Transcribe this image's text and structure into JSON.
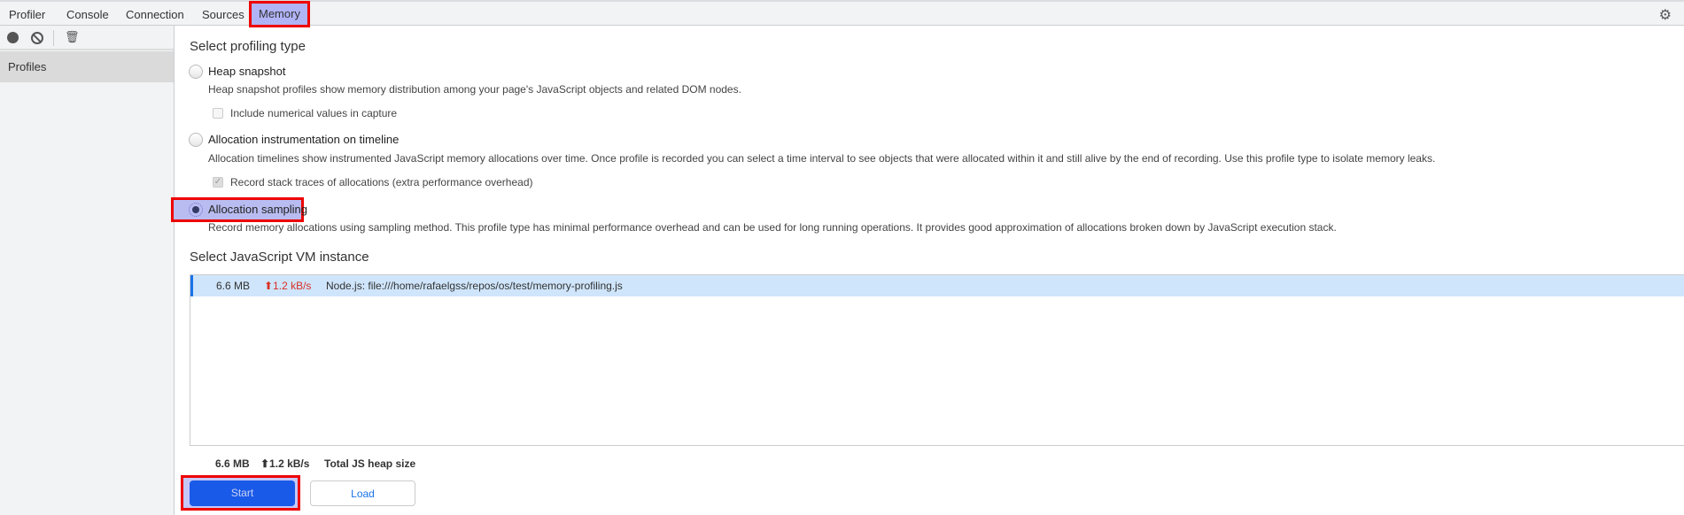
{
  "tabs": [
    {
      "label": "Profiler"
    },
    {
      "label": "Console"
    },
    {
      "label": "Connection"
    },
    {
      "label": "Sources"
    },
    {
      "label": "Memory"
    }
  ],
  "active_tab": "Memory",
  "sidebar": {
    "profiles_label": "Profiles"
  },
  "main": {
    "profiling_type_title": "Select profiling type",
    "options": [
      {
        "label": "Heap snapshot",
        "description": "Heap snapshot profiles show memory distribution among your page's JavaScript objects and related DOM nodes.",
        "checkbox": "Include numerical values in capture",
        "checked": false,
        "selected": false
      },
      {
        "label": "Allocation instrumentation on timeline",
        "description": "Allocation timelines show instrumented JavaScript memory allocations over time. Once profile is recorded you can select a time interval to see objects that were allocated within it and still alive by the end of recording. Use this profile type to isolate memory leaks.",
        "checkbox": "Record stack traces of allocations (extra performance overhead)",
        "checked": true,
        "selected": false
      },
      {
        "label": "Allocation sampling",
        "description": "Record memory allocations using sampling method. This profile type has minimal performance overhead and can be used for long running operations. It provides good approximation of allocations broken down by JavaScript execution stack.",
        "selected": true
      }
    ],
    "vm_title": "Select JavaScript VM instance",
    "vm_instances": [
      {
        "size": "6.6 MB",
        "rate": "⬆1.2 kB/s",
        "name": "Node.js: file:///home/rafaelgss/repos/os/test/memory-profiling.js"
      }
    ],
    "footer": {
      "size": "6.6 MB",
      "rate": "⬆1.2 kB/s",
      "label": "Total JS heap size"
    },
    "start_label": "Start",
    "load_label": "Load"
  },
  "colors": {
    "accent": "#1a5ae8",
    "rate": "#d93025",
    "highlight": "#b0b3f5"
  }
}
